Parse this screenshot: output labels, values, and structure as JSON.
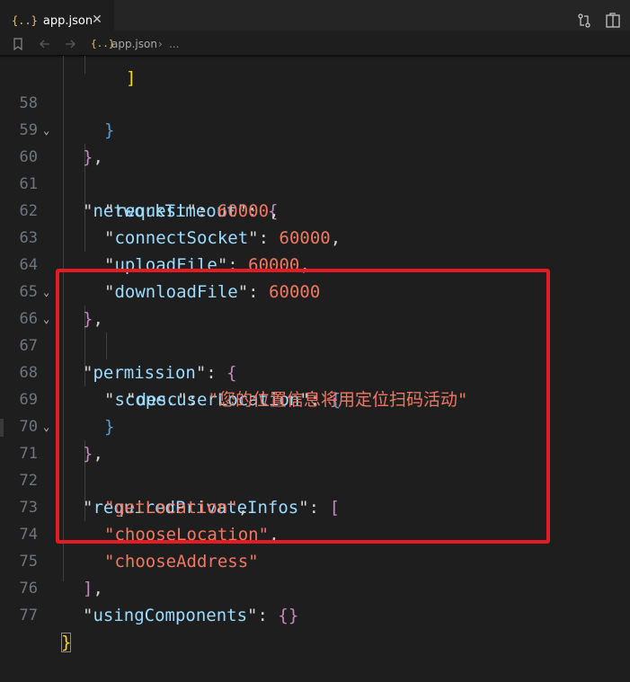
{
  "tab": {
    "icon": "{..}",
    "label": "app.json",
    "close": "✕"
  },
  "breadcrumb": {
    "file_icon": "{..}",
    "file": "app.json",
    "separator": "›",
    "more": "..."
  },
  "colors": {
    "annotation_box": "#e31b23",
    "string": "#f07863",
    "key": "#9cdcfe"
  },
  "lines": {
    "l58": {
      "n": "58"
    },
    "l59": {
      "n": "59"
    },
    "l60": {
      "n": "60",
      "key": "networkTimeout"
    },
    "l61": {
      "n": "61",
      "key": "request",
      "val": "60000"
    },
    "l62": {
      "n": "62",
      "key": "connectSocket",
      "val": "60000"
    },
    "l63": {
      "n": "63",
      "key": "uploadFile",
      "val": "60000"
    },
    "l64": {
      "n": "64",
      "key": "downloadFile",
      "val": "60000"
    },
    "l65": {
      "n": "65"
    },
    "l66": {
      "n": "66",
      "key": "permission"
    },
    "l67": {
      "n": "67",
      "key": "scope.userLocation"
    },
    "l68": {
      "n": "68",
      "key": "desc",
      "val": "您的位置信息将用定位扫码活动"
    },
    "l69": {
      "n": "69"
    },
    "l70": {
      "n": "70"
    },
    "l71": {
      "n": "71",
      "key": "requiredPrivateInfos"
    },
    "l72": {
      "n": "72",
      "val": "getLocation"
    },
    "l73": {
      "n": "73",
      "val": "chooseLocation"
    },
    "l74": {
      "n": "74",
      "val": "chooseAddress"
    },
    "l75": {
      "n": "75"
    },
    "l76": {
      "n": "76",
      "key": "usingComponents"
    },
    "l77": {
      "n": "77"
    }
  }
}
